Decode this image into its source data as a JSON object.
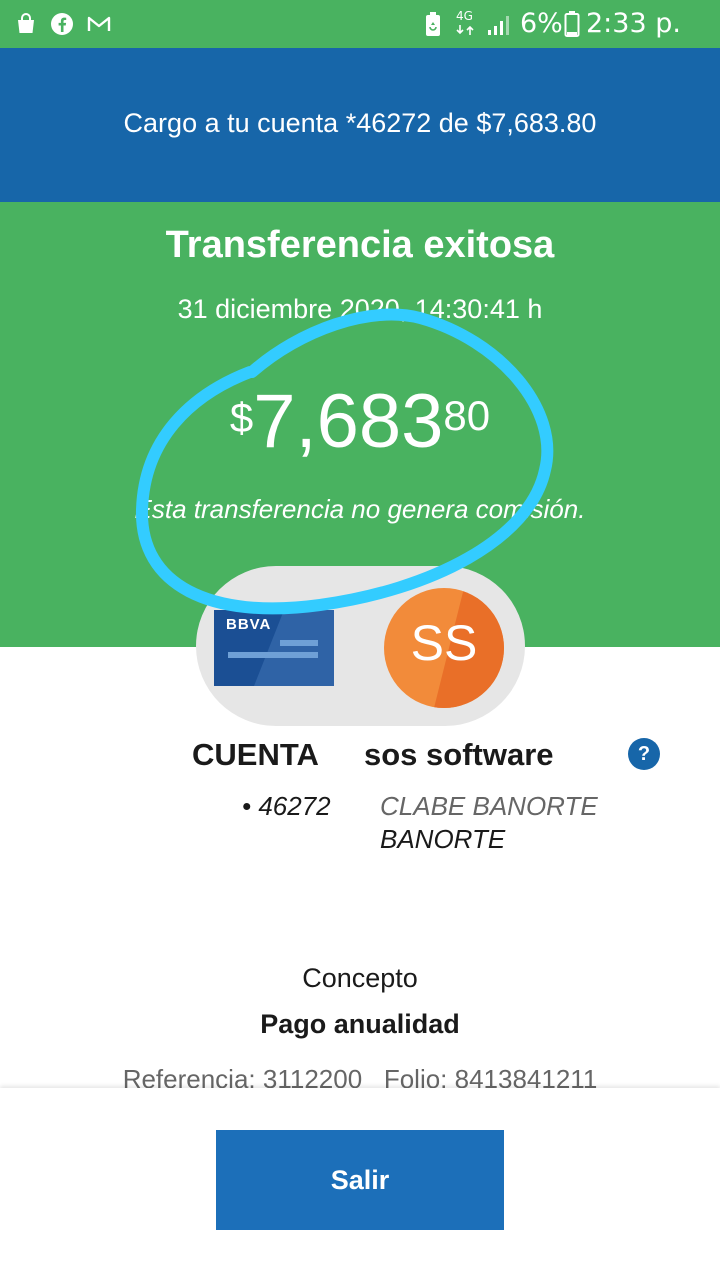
{
  "status_bar": {
    "network": "4G",
    "battery": "6%",
    "time": "2:33 p. m.",
    "left_icons": [
      "shopping-bag-icon",
      "facebook-icon",
      "gmail-icon"
    ],
    "right_icons": [
      "battery-saver-icon",
      "network-4g-icon",
      "signal-icon",
      "battery-icon"
    ]
  },
  "header": {
    "charge_text": "Cargo a tu cuenta *46272 de $7,683.80"
  },
  "result": {
    "title": "Transferencia exitosa",
    "datetime": "31 diciembre 2020, 14:30:41 h",
    "amount_currency": "$",
    "amount_main": "7,683",
    "amount_cents": "80",
    "commission_note": "Esta transferencia no genera comisión."
  },
  "origin": {
    "card_brand": "BBVA",
    "label": "CUENTA",
    "account": "• 46272"
  },
  "destination": {
    "initials": "SS",
    "name": "sos software",
    "clabe": "CLABE BANORTE",
    "bank": "BANORTE"
  },
  "help_label": "?",
  "concept": {
    "label": "Concepto",
    "value": "Pago anualidad"
  },
  "refs": {
    "text": "Referencia: 3112200   Folio: 8413841211"
  },
  "actions": {
    "exit_label": "Salir"
  },
  "colors": {
    "status_green": "#49b260",
    "header_blue": "#1766a9",
    "button_blue": "#1c6fb9",
    "avatar_orange": "#f28b3a",
    "annotation_cyan": "#33ccff"
  }
}
